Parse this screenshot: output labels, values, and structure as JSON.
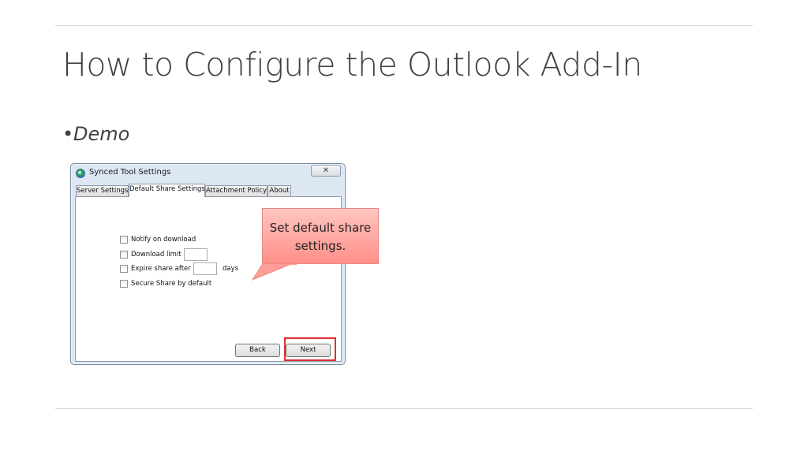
{
  "slide": {
    "title": "How to Configure the Outlook Add-In",
    "bullet": "Demo"
  },
  "dialog": {
    "title": "Synced Tool Settings",
    "close_glyph": "✕",
    "tabs": [
      "Server Settings",
      "Default Share Settings",
      "Attachment Policy",
      "About"
    ],
    "active_tab": "Default Share Settings",
    "options": [
      {
        "label": "Notify on download",
        "checked": false
      },
      {
        "label": "Download limit",
        "checked": false
      },
      {
        "label": "Expire share after",
        "checked": false
      },
      {
        "label": "Secure Share by default",
        "checked": false
      }
    ],
    "days_label": "days",
    "back_label": "Back",
    "next_label": "Next"
  },
  "callout": {
    "text_line1": "Set default share",
    "text_line2": "settings."
  },
  "colors": {
    "highlight": "#e03030",
    "callout_fill": "#ff9f99"
  }
}
